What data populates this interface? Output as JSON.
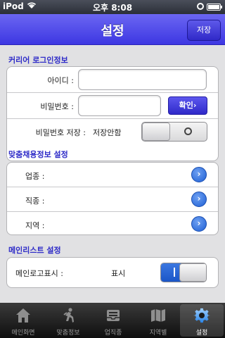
{
  "status_bar": {
    "carrier": "iPod",
    "time": "오후 8:08",
    "battery_level": 1.0
  },
  "nav": {
    "title": "설정",
    "save_label": "저장"
  },
  "carrier_login": {
    "header": "커리어 로그인정보",
    "id_label": "아이디 :",
    "id_value": "",
    "password_label": "비밀번호 :",
    "password_value": "",
    "confirm_label": "확인›",
    "save_password_label": "비밀번호 저장 :",
    "save_password_status": "저장안함",
    "save_password_on": false
  },
  "custom_job": {
    "header": "맞춤채용정보 설정",
    "items": [
      {
        "label": "업종 :",
        "value": ""
      },
      {
        "label": "직종 :",
        "value": ""
      },
      {
        "label": "지역 :",
        "value": ""
      }
    ]
  },
  "main_list": {
    "header": "메인리스트 설정",
    "logo_label": "메인로고표시 :",
    "logo_status": "표시",
    "logo_on": true
  },
  "tab_bar": {
    "tabs": [
      {
        "label": "메인화면",
        "icon": "house-icon"
      },
      {
        "label": "맞춤정보",
        "icon": "runner-icon"
      },
      {
        "label": "업직종",
        "icon": "inbox-icon"
      },
      {
        "label": "지역별",
        "icon": "map-icon"
      },
      {
        "label": "설정",
        "icon": "gear-icon"
      }
    ],
    "active": 4
  },
  "colors": {
    "nav_bar": "#4a44e8",
    "section_header": "#2f2cc8",
    "toggle_on": "#1b56c8",
    "tab_bar": "#1a1a1a"
  }
}
